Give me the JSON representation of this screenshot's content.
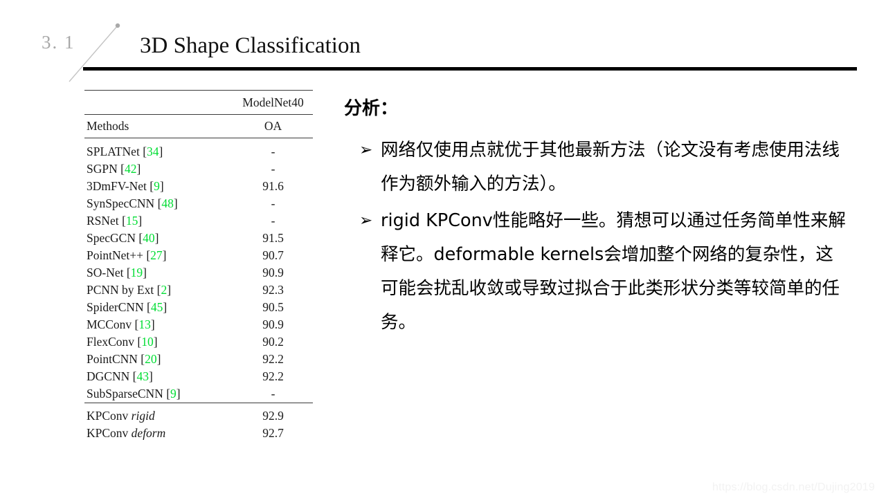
{
  "header": {
    "section_number": "3. 1",
    "title": "3D Shape Classification"
  },
  "table": {
    "dataset_header": "ModelNet40",
    "columns": [
      "Methods",
      "OA"
    ],
    "rows": [
      {
        "method": "SPLATNet",
        "cite": "34",
        "oa": "-"
      },
      {
        "method": "SGPN",
        "cite": "42",
        "oa": "-"
      },
      {
        "method": "3DmFV-Net",
        "cite": "9",
        "oa": "91.6"
      },
      {
        "method": "SynSpecCNN",
        "cite": "48",
        "oa": "-"
      },
      {
        "method": "RSNet",
        "cite": "15",
        "oa": "-"
      },
      {
        "method": "SpecGCN",
        "cite": "40",
        "oa": "91.5"
      },
      {
        "method": "PointNet++",
        "cite": "27",
        "oa": "90.7"
      },
      {
        "method": "SO-Net",
        "cite": "19",
        "oa": "90.9"
      },
      {
        "method": "PCNN by Ext",
        "cite": "2",
        "oa": "92.3"
      },
      {
        "method": "SpiderCNN",
        "cite": "45",
        "oa": "90.5"
      },
      {
        "method": "MCConv",
        "cite": "13",
        "oa": "90.9"
      },
      {
        "method": "FlexConv",
        "cite": "10",
        "oa": "90.2"
      },
      {
        "method": "PointCNN",
        "cite": "20",
        "oa": "92.2"
      },
      {
        "method": "DGCNN",
        "cite": "43",
        "oa": "92.2"
      },
      {
        "method": "SubSparseCNN",
        "cite": "9",
        "oa": "-"
      }
    ],
    "highlight_rows": [
      {
        "method": "KPConv",
        "variant": "rigid",
        "oa": "92.9",
        "bold": true
      },
      {
        "method": "KPConv",
        "variant": "deform",
        "oa": "92.7",
        "bold": false
      }
    ],
    "citation_color": "#00dd33"
  },
  "analysis": {
    "label": "分析：",
    "bullet_glyph": "➢",
    "bullets": [
      "网络仅使用点就优于其他最新方法（论文没有考虑使用法线作为额外输入的方法）。",
      "rigid KPConv性能略好一些。猜想可以通过任务简单性来解释它。deformable kernels会增加整个网络的复杂性，这可能会扰乱收敛或导致过拟合于此类形状分类等较简单的任务。"
    ]
  },
  "watermark": {
    "text": "https://blog.csdn.net/Dujing2019"
  }
}
